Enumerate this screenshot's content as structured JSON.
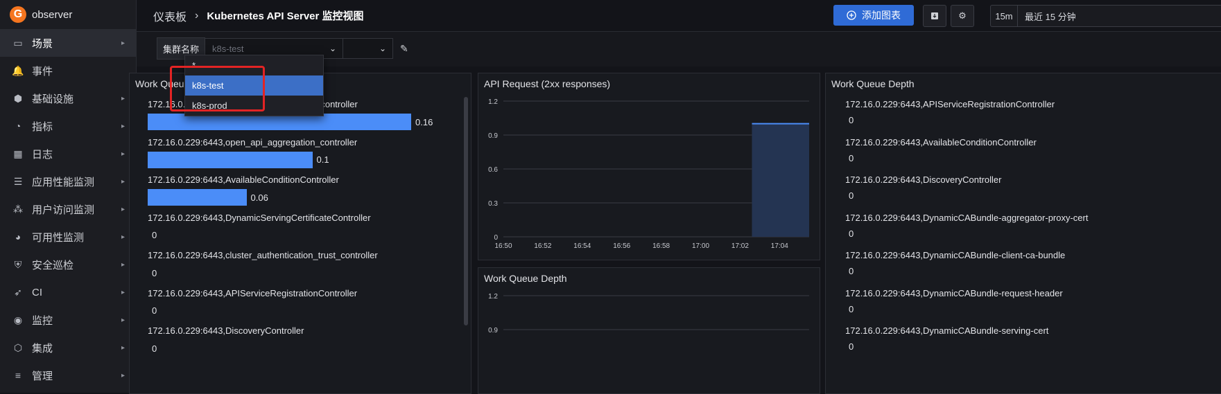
{
  "app": {
    "name": "observer",
    "logo_letter": "G"
  },
  "sidebar": {
    "items": [
      {
        "label": "场景",
        "icon": "monitor-icon",
        "glyph": "▭",
        "arrow": true,
        "active": true
      },
      {
        "label": "事件",
        "icon": "bell-icon",
        "glyph": "🔔",
        "arrow": false,
        "active": false
      },
      {
        "label": "基础设施",
        "icon": "cubes-icon",
        "glyph": "⬢",
        "arrow": true,
        "active": false
      },
      {
        "label": "指标",
        "icon": "gauge-icon",
        "glyph": "◔",
        "arrow": true,
        "active": false
      },
      {
        "label": "日志",
        "icon": "calendar-icon",
        "glyph": "▦",
        "arrow": true,
        "active": false
      },
      {
        "label": "应用性能监测",
        "icon": "filter-icon",
        "glyph": "☰",
        "arrow": true,
        "active": false
      },
      {
        "label": "用户访问监测",
        "icon": "users-icon",
        "glyph": "⁂",
        "arrow": true,
        "active": false
      },
      {
        "label": "可用性监测",
        "icon": "pie-icon",
        "glyph": "◕",
        "arrow": true,
        "active": false
      },
      {
        "label": "安全巡检",
        "icon": "shield-icon",
        "glyph": "⛨",
        "arrow": true,
        "active": false
      },
      {
        "label": "CI",
        "icon": "rocket-icon",
        "glyph": "➶",
        "arrow": true,
        "active": false
      },
      {
        "label": "监控",
        "icon": "radar-icon",
        "glyph": "◉",
        "arrow": true,
        "active": false
      },
      {
        "label": "集成",
        "icon": "box-icon",
        "glyph": "⬡",
        "arrow": true,
        "active": false
      },
      {
        "label": "管理",
        "icon": "sliders-icon",
        "glyph": "≡",
        "arrow": true,
        "active": false
      }
    ]
  },
  "header": {
    "breadcrumb_root": "仪表板",
    "breadcrumb_sep": "›",
    "page_title": "Kubernetes API Server 监控视图",
    "add_chart_label": "添加图表",
    "time_quick": "15m",
    "time_label": "最近 15 分钟"
  },
  "variables": {
    "cluster_label": "集群名称",
    "cluster_placeholder": "k8s-test",
    "options": [
      "*",
      "k8s-test",
      "k8s-prod"
    ],
    "selected": "k8s-test"
  },
  "panels": {
    "work_queue_left": {
      "title": "Work Queue Adds",
      "rows": [
        {
          "label": "172.16.0.229:6443,apiservice_registration_controller",
          "value": 0.16,
          "display": "0.16"
        },
        {
          "label": "172.16.0.229:6443,open_api_aggregation_controller",
          "value": 0.1,
          "display": "0.1"
        },
        {
          "label": "172.16.0.229:6443,AvailableConditionController",
          "value": 0.06,
          "display": "0.06"
        },
        {
          "label": "172.16.0.229:6443,DynamicServingCertificateController",
          "value": 0,
          "display": "0"
        },
        {
          "label": "172.16.0.229:6443,cluster_authentication_trust_controller",
          "value": 0,
          "display": "0"
        },
        {
          "label": "172.16.0.229:6443,APIServiceRegistrationController",
          "value": 0,
          "display": "0"
        },
        {
          "label": "172.16.0.229:6443,DiscoveryController",
          "value": 0,
          "display": "0"
        }
      ]
    },
    "api_request": {
      "title": "API Request (2xx responses)"
    },
    "work_queue_depth_mid": {
      "title": "Work Queue Depth"
    },
    "work_queue_depth_right": {
      "title": "Work Queue Depth",
      "rows": [
        {
          "label": "172.16.0.229:6443,APIServiceRegistrationController",
          "display": "0"
        },
        {
          "label": "172.16.0.229:6443,AvailableConditionController",
          "display": "0"
        },
        {
          "label": "172.16.0.229:6443,DiscoveryController",
          "display": "0"
        },
        {
          "label": "172.16.0.229:6443,DynamicCABundle-aggregator-proxy-cert",
          "display": "0"
        },
        {
          "label": "172.16.0.229:6443,DynamicCABundle-client-ca-bundle",
          "display": "0"
        },
        {
          "label": "172.16.0.229:6443,DynamicCABundle-request-header",
          "display": "0"
        },
        {
          "label": "172.16.0.229:6443,DynamicCABundle-serving-cert",
          "display": "0"
        }
      ]
    }
  },
  "chart_data": [
    {
      "type": "area",
      "title": "API Request (2xx responses)",
      "x": [
        "16:50",
        "16:52",
        "16:54",
        "16:56",
        "16:58",
        "17:00",
        "17:02",
        "17:04"
      ],
      "yticks": [
        0,
        0.3,
        0.6,
        0.9,
        1.2
      ],
      "ylim": [
        0,
        1.2
      ],
      "xlim_minutes": [
        0,
        15.5
      ],
      "series": [
        {
          "x_start_minutes": 12.6,
          "x_end_minutes": 15.5,
          "value": 1
        }
      ],
      "grid": true
    },
    {
      "type": "line",
      "title": "Work Queue Depth",
      "yticks": [
        0.9,
        1.2
      ],
      "ylim": [
        0,
        1.2
      ],
      "grid": true
    }
  ],
  "colors": {
    "accent": "#2f6bd6",
    "bar": "#4b8df8",
    "highlight": "#e32424",
    "logo": "#f5751f"
  }
}
